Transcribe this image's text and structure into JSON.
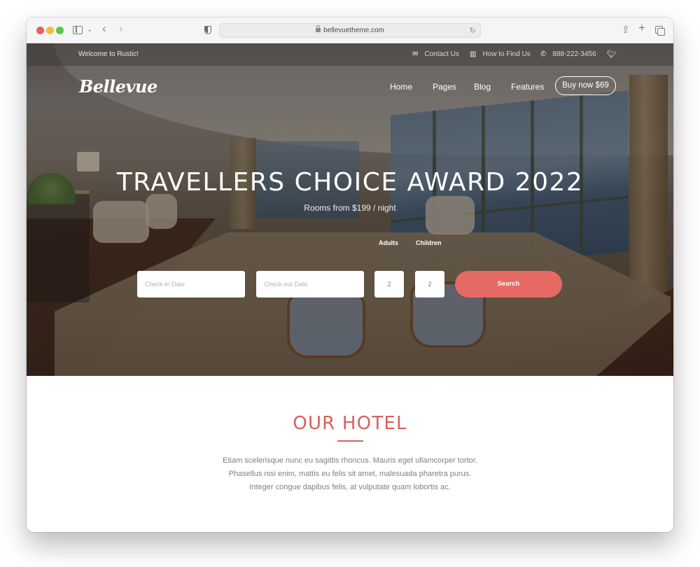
{
  "browser": {
    "url": "bellevuetheme.com",
    "icons": [
      "sidebar-icon",
      "chevron-down-icon",
      "back-icon",
      "forward-icon",
      "shield-icon",
      "lock-icon",
      "reload-icon",
      "share-icon",
      "new-tab-icon",
      "tabs-overview-icon"
    ]
  },
  "topbar": {
    "welcome": "Welcome to Rustic!",
    "items": [
      {
        "icon": "envelope-icon",
        "label": "Contact Us"
      },
      {
        "icon": "map-icon",
        "label": "How to Find Us"
      },
      {
        "icon": "phone-icon",
        "label": "888-222-3456"
      },
      {
        "icon": "twitter-icon",
        "label": ""
      }
    ]
  },
  "nav": {
    "logo": "Bellevue",
    "links": [
      "Home",
      "Pages",
      "Blog",
      "Features"
    ],
    "cta": "Buy now $69"
  },
  "hero": {
    "title": "TRAVELLERS CHOICE AWARD 2022",
    "subtitle": "Rooms from $199 / night"
  },
  "booking": {
    "checkin_placeholder": "Check-in Date",
    "checkout_placeholder": "Check-out Date",
    "adults_label": "Adults",
    "children_label": "Children",
    "adults_value": "2",
    "children_value": "2",
    "search_label": "Search"
  },
  "section": {
    "title": "OUR HOTEL",
    "lines": [
      "Etiam scelerisque nunc eu sagittis rhoncus. Mauris eget ullamcorper tortor.",
      "Phasellus nisi enim, mattis eu felis sit amet, malesuada pharetra purus.",
      "Integer congue dapibus felis, at vulputate quam lobortis ac."
    ]
  },
  "colors": {
    "accent": "#e66a64",
    "heading": "#d5625e",
    "body_text": "#808080"
  }
}
